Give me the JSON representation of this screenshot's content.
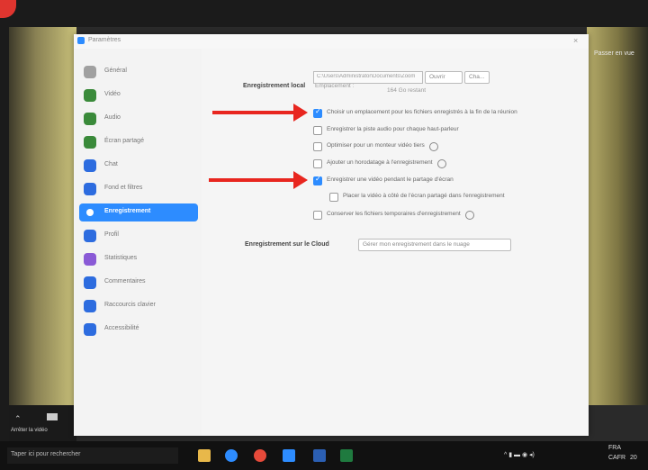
{
  "window": {
    "title": "Paramètres"
  },
  "sidebar": {
    "items": [
      {
        "label": "Général",
        "color": "#a0a0a0",
        "icon": "gear-icon"
      },
      {
        "label": "Vidéo",
        "color": "#3a8a3a",
        "icon": "video-icon"
      },
      {
        "label": "Audio",
        "color": "#3a8a3a",
        "icon": "headphones-icon"
      },
      {
        "label": "Écran partagé",
        "color": "#3a8a3a",
        "icon": "share-screen-icon"
      },
      {
        "label": "Chat",
        "color": "#2d6cdf",
        "icon": "chat-icon"
      },
      {
        "label": "Fond et filtres",
        "color": "#2d6cdf",
        "icon": "background-icon"
      },
      {
        "label": "Enregistrement",
        "color": "#ffffff",
        "icon": "record-icon"
      },
      {
        "label": "Profil",
        "color": "#2d6cdf",
        "icon": "profile-icon"
      },
      {
        "label": "Statistiques",
        "color": "#8a5ad6",
        "icon": "statistics-icon"
      },
      {
        "label": "Commentaires",
        "color": "#2d6cdf",
        "icon": "feedback-icon"
      },
      {
        "label": "Raccourcis clavier",
        "color": "#2d6cdf",
        "icon": "keyboard-icon"
      },
      {
        "label": "Accessibilité",
        "color": "#2d6cdf",
        "icon": "accessibility-icon"
      }
    ],
    "active_index": 6
  },
  "local": {
    "title": "Enregistrement local",
    "location_label": "Emplacement :",
    "path": "C:\\Users\\Administrator\\Documents\\Zoom",
    "open_button": "Ouvrir",
    "change_button": "Cha...",
    "free_space": "164 Go restant",
    "options": [
      {
        "label": "Choisir un emplacement pour les fichiers enregistrés à la fin de la réunion",
        "checked": true,
        "help": false
      },
      {
        "label": "Enregistrer la piste audio pour chaque haut-parleur",
        "checked": false,
        "help": false
      },
      {
        "label": "Optimiser pour un monteur vidéo tiers",
        "checked": false,
        "help": true
      },
      {
        "label": "Ajouter un horodatage à l'enregistrement",
        "checked": false,
        "help": true
      },
      {
        "label": "Enregistrer une vidéo pendant le partage d'écran",
        "checked": true,
        "help": false
      },
      {
        "label": "Placer la vidéo à côté de l'écran partagé dans l'enregistrement",
        "checked": false,
        "help": false
      },
      {
        "label": "Conserver les fichiers temporaires d'enregistrement",
        "checked": false,
        "help": true
      }
    ]
  },
  "cloud": {
    "title": "Enregistrement sur le Cloud",
    "manage_button": "Gérer mon enregistrement dans le nuage"
  },
  "taskbar": {
    "search_placeholder": "Taper ici pour rechercher",
    "lang": "FRA",
    "region": "CAFR",
    "time": "20"
  },
  "background": {
    "right_label": "Passer en vue",
    "bottom_left": "Arrêter la vidéo"
  }
}
